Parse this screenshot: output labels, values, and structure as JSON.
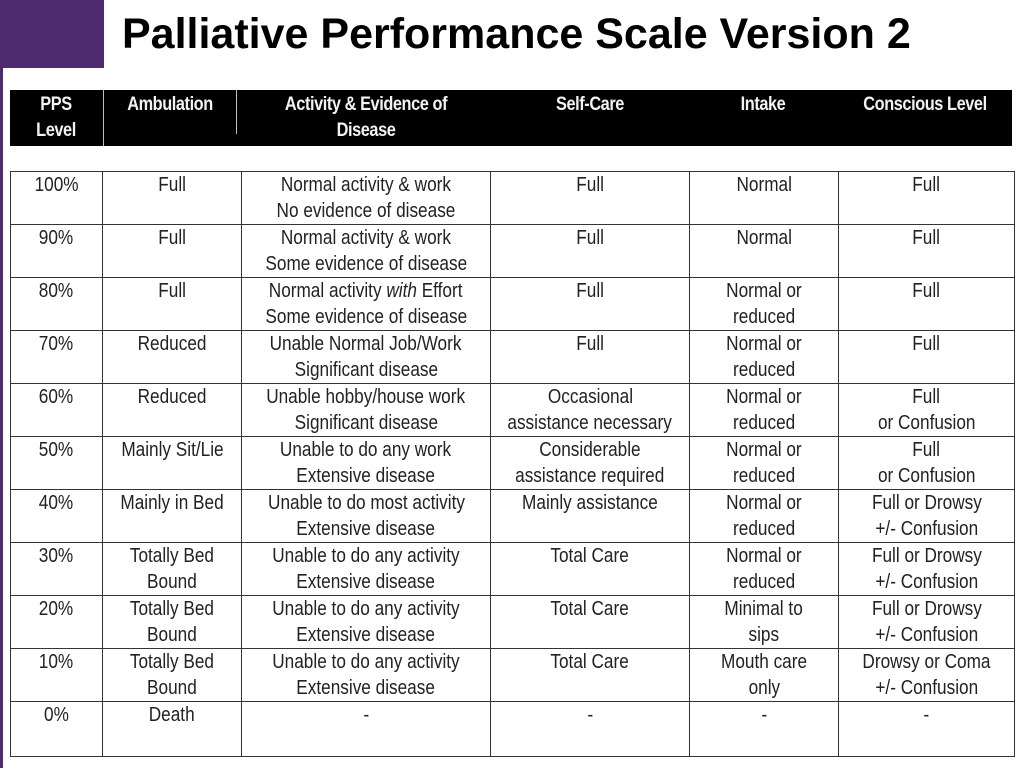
{
  "title": "Palliative Performance Scale Version 2",
  "colors": {
    "accent_purple": "#4f2a6e",
    "header_bg": "#000000",
    "header_text": "#ffffff"
  },
  "table": {
    "headers": [
      {
        "line1": "PPS",
        "line2": "Level"
      },
      {
        "line1": "Ambulation",
        "line2": ""
      },
      {
        "line1": "Activity & Evidence of",
        "line2": "Disease"
      },
      {
        "line1": "Self-Care",
        "line2": ""
      },
      {
        "line1": "Intake",
        "line2": ""
      },
      {
        "line1": "Conscious Level",
        "line2": ""
      }
    ],
    "rows": [
      {
        "level": "100%",
        "ambulation": [
          "Full"
        ],
        "activity": [
          "Normal activity & work",
          "No evidence of disease"
        ],
        "selfcare": [
          "Full"
        ],
        "intake": [
          "Normal"
        ],
        "conscious": [
          "Full"
        ]
      },
      {
        "level": "90%",
        "ambulation": [
          "Full"
        ],
        "activity": [
          "Normal activity & work",
          "Some evidence of disease"
        ],
        "selfcare": [
          "Full"
        ],
        "intake": [
          "Normal"
        ],
        "conscious": [
          "Full"
        ]
      },
      {
        "level": "80%",
        "ambulation": [
          "Full"
        ],
        "activity": [
          "Normal activity with Effort",
          "Some evidence of disease"
        ],
        "selfcare": [
          "Full"
        ],
        "intake": [
          "Normal or",
          "reduced"
        ],
        "conscious": [
          "Full"
        ]
      },
      {
        "level": "70%",
        "ambulation": [
          "Reduced"
        ],
        "activity": [
          "Unable Normal Job/Work",
          "Significant disease"
        ],
        "selfcare": [
          "Full"
        ],
        "intake": [
          "Normal or",
          "reduced"
        ],
        "conscious": [
          "Full"
        ]
      },
      {
        "level": "60%",
        "ambulation": [
          "Reduced"
        ],
        "activity": [
          "Unable hobby/house work",
          "Significant disease"
        ],
        "selfcare": [
          "Occasional",
          "assistance necessary"
        ],
        "intake": [
          "Normal or",
          "reduced"
        ],
        "conscious": [
          "Full",
          "or Confusion"
        ]
      },
      {
        "level": "50%",
        "ambulation": [
          "Mainly Sit/Lie"
        ],
        "activity": [
          "Unable to do any work",
          "Extensive disease"
        ],
        "selfcare": [
          "Considerable",
          "assistance required"
        ],
        "intake": [
          "Normal or",
          "reduced"
        ],
        "conscious": [
          "Full",
          "or Confusion"
        ]
      },
      {
        "level": "40%",
        "ambulation": [
          "Mainly in Bed"
        ],
        "activity": [
          "Unable to do most activity",
          "Extensive disease"
        ],
        "selfcare": [
          "Mainly assistance"
        ],
        "intake": [
          "Normal or",
          "reduced"
        ],
        "conscious": [
          "Full or Drowsy",
          "+/- Confusion"
        ]
      },
      {
        "level": "30%",
        "ambulation": [
          "Totally Bed",
          "Bound"
        ],
        "activity": [
          "Unable to do any activity",
          "Extensive disease"
        ],
        "selfcare": [
          "Total Care"
        ],
        "intake": [
          "Normal or",
          "reduced"
        ],
        "conscious": [
          "Full or Drowsy",
          "+/- Confusion"
        ]
      },
      {
        "level": "20%",
        "ambulation": [
          "Totally Bed",
          "Bound"
        ],
        "activity": [
          "Unable to do any activity",
          "Extensive disease"
        ],
        "selfcare": [
          "Total Care"
        ],
        "intake": [
          "Minimal to",
          "sips"
        ],
        "conscious": [
          "Full or Drowsy",
          "+/- Confusion"
        ]
      },
      {
        "level": "10%",
        "ambulation": [
          "Totally Bed",
          "Bound"
        ],
        "activity": [
          "Unable to do any activity",
          "Extensive disease"
        ],
        "selfcare": [
          "Total Care"
        ],
        "intake": [
          "Mouth care",
          "only"
        ],
        "conscious": [
          "Drowsy or Coma",
          "+/- Confusion"
        ]
      },
      {
        "level": "0%",
        "ambulation": [
          "Death"
        ],
        "activity": [
          "-"
        ],
        "selfcare": [
          "-"
        ],
        "intake": [
          "-"
        ],
        "conscious": [
          "-"
        ]
      }
    ]
  }
}
